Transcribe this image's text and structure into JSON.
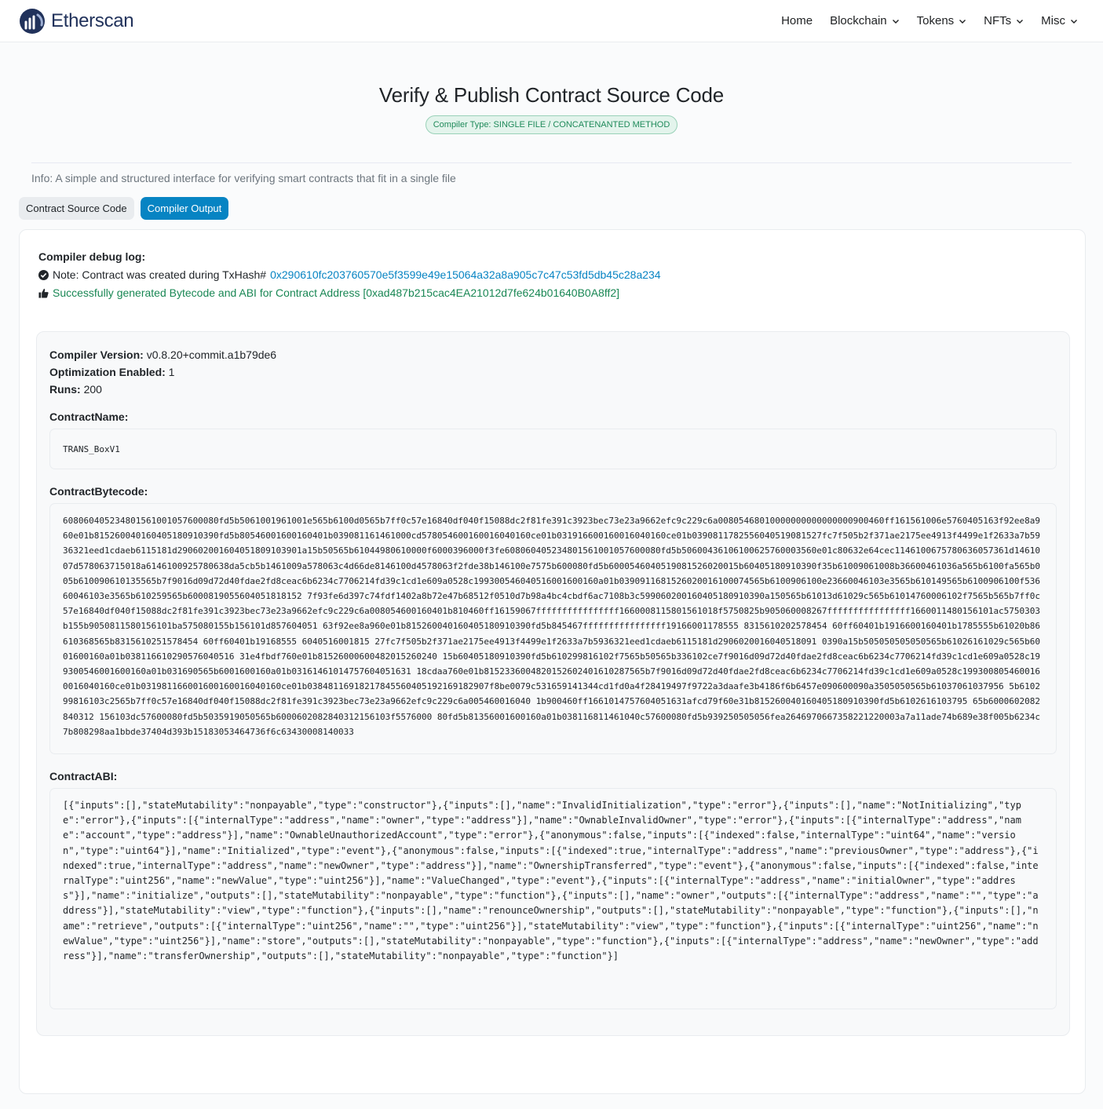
{
  "brand": {
    "name": "Etherscan"
  },
  "nav": {
    "items": [
      {
        "label": "Home",
        "dropdown": false
      },
      {
        "label": "Blockchain",
        "dropdown": true
      },
      {
        "label": "Tokens",
        "dropdown": true
      },
      {
        "label": "NFTs",
        "dropdown": true
      },
      {
        "label": "Misc",
        "dropdown": true
      }
    ]
  },
  "header": {
    "title": "Verify & Publish Contract Source Code",
    "badge": "Compiler Type: SINGLE FILE / CONCATENANTED METHOD",
    "info": "Info: A simple and structured interface for verifying smart contracts that fit in a single file"
  },
  "tabs": {
    "source": "Contract Source Code",
    "output": "Compiler Output"
  },
  "debug": {
    "title": "Compiler debug log:",
    "note_prefix": "Note: Contract was created during TxHash# ",
    "tx_hash": "0x290610fc203760570e5f3599e49e15064a32a8a905c7c47c53fd5db45c28a234",
    "success": "Successfully generated Bytecode and ABI for Contract Address [0xad487b215cac4EA21012d7fe624b01640B0A8ff2]"
  },
  "details": {
    "compiler_label": "Compiler Version:",
    "compiler_value": "v0.8.20+commit.a1b79de6",
    "optimization_label": "Optimization Enabled:",
    "optimization_value": "1",
    "runs_label": "Runs:",
    "runs_value": "200",
    "contract_name_label": "ContractName:",
    "contract_name": "TRANS_BoxV1",
    "bytecode_label": "ContractBytecode:",
    "bytecode": "608060405234801561001057600080fd5b5061001961001e565b6100d0565b7ff0c57e16840df040f15088dc2f81fe391c3923bec73e23a9662efc9c229c6a00805468010000000000000000900460ff161561006e5760405163f92ee8a960e01b815260040160405180910390fd5b80546001600160401b039081161461000cd578054600160016040160ce01b031916600160016040160ce01b0390811782556040519081527fc7f505b2f371ae2175ee4913f4499e1f2633a7b5936321eed1cdaeb6115181d290602001604051809103901a15b50565b61044980610000f6000396000f3fe608060405234801561001057600080fd5b50600436106100625760003560e01c80632e64cec1146100675780636057361d1461007d578063715018a6146100925780638da5cb5b1461009a578063c4d66de8146100d4578063f2fde38b146100e7575b600080fd5b6000546040519081526020015b60405180910390f35b61009061008b36600461036a565b6100fa565b005b610090610135565b7f9016d09d72d40fdae2fd8ceac6b6234c7706214fd39c1cd1e609a0528c199300546040516001600160a01b0390911681526020016100074565b6100906100e23660046103e3565b610149565b6100906100f53660046103e3565b610259565b6000819055604051818152 7f93fe6d397c74fdf1402a8b72e47b68512f0510d7b98a4bc4cbdf6ac7108b3c599060200160405180910390a150565b61013d61029c565b61014760006102f7565b565b7ff0c57e16840df040f15088dc2f81fe391c3923bec73e23a9662efc9c229c6a008054600160401b810460ff16159067ffffffffffffffff1660008115801561018f5750825b905060008267ffffffffffffffff1660011480156101ac5750303b155b9050811580156101ba575080155b156101d857604051 63f92ee8a960e01b815260040160405180910390fd5b845467ffffffffffffffff19166001178555 8315610202578454 60ff60401b1916600160401b1785555b61020b86610368565b8315610251578454 60ff60401b19168555 6040516001815 27fc7f505b2f371ae2175ee4913f4499e1f2633a7b5936321eed1cdaeb6115181d2906020016040518091 0390a15b505050505050565b61026161029c565b6001600160a01b038116610290576040516 31e4fbdf760e01b81526000600482015260240 15b60405180910390fd5b610299816102f7565b50565b336102ce7f9016d09d72d40fdae2fd8ceac6b6234c7706214fd39c1cd1e609a0528c199300546001600160a01b031690565b6001600160a01b03161461014757604051631 18cdaa760e01b8152336004820152602401610287565b7f9016d09d72d40fdae2fd8ceac6b6234c7706214fd39c1cd1e609a0528c1993008054600160016040160ce01b031981166001600160016040160ce01b03848116918217845560405192169182907f8be0079c531659141344cd1fd0a4f28419497f9722a3daafe3b4186f6b6457e090600090a3505050565b61037061037956 5b610299816103c2565b7ff0c57e16840df040f15088dc2f81fe391c3923bec73e23a9662efc9c229c6a005460016040 1b900460ff1661014757604051631afcd79f60e31b815260040160405180910390fd5b6102616103795 65b6000602082840312 156103dc57600080fd5b5035919050565b6000602082840312156103f5576000 80fd5b81356001600160a01b038116811461040c57600080fd5b939250505056fea2646970667358221220003a7a11ade74b689e38f005b6234c7b808298aa1bbde37404d393b15183053464736f6c63430008140033",
    "abi_label": "ContractABI:",
    "abi": "[{\"inputs\":[],\"stateMutability\":\"nonpayable\",\"type\":\"constructor\"},{\"inputs\":[],\"name\":\"InvalidInitialization\",\"type\":\"error\"},{\"inputs\":[],\"name\":\"NotInitializing\",\"type\":\"error\"},{\"inputs\":[{\"internalType\":\"address\",\"name\":\"owner\",\"type\":\"address\"}],\"name\":\"OwnableInvalidOwner\",\"type\":\"error\"},{\"inputs\":[{\"internalType\":\"address\",\"name\":\"account\",\"type\":\"address\"}],\"name\":\"OwnableUnauthorizedAccount\",\"type\":\"error\"},{\"anonymous\":false,\"inputs\":[{\"indexed\":false,\"internalType\":\"uint64\",\"name\":\"version\",\"type\":\"uint64\"}],\"name\":\"Initialized\",\"type\":\"event\"},{\"anonymous\":false,\"inputs\":[{\"indexed\":true,\"internalType\":\"address\",\"name\":\"previousOwner\",\"type\":\"address\"},{\"indexed\":true,\"internalType\":\"address\",\"name\":\"newOwner\",\"type\":\"address\"}],\"name\":\"OwnershipTransferred\",\"type\":\"event\"},{\"anonymous\":false,\"inputs\":[{\"indexed\":false,\"internalType\":\"uint256\",\"name\":\"newValue\",\"type\":\"uint256\"}],\"name\":\"ValueChanged\",\"type\":\"event\"},{\"inputs\":[{\"internalType\":\"address\",\"name\":\"initialOwner\",\"type\":\"address\"}],\"name\":\"initialize\",\"outputs\":[],\"stateMutability\":\"nonpayable\",\"type\":\"function\"},{\"inputs\":[],\"name\":\"owner\",\"outputs\":[{\"internalType\":\"address\",\"name\":\"\",\"type\":\"address\"}],\"stateMutability\":\"view\",\"type\":\"function\"},{\"inputs\":[],\"name\":\"renounceOwnership\",\"outputs\":[],\"stateMutability\":\"nonpayable\",\"type\":\"function\"},{\"inputs\":[],\"name\":\"retrieve\",\"outputs\":[{\"internalType\":\"uint256\",\"name\":\"\",\"type\":\"uint256\"}],\"stateMutability\":\"view\",\"type\":\"function\"},{\"inputs\":[{\"internalType\":\"uint256\",\"name\":\"newValue\",\"type\":\"uint256\"}],\"name\":\"store\",\"outputs\":[],\"stateMutability\":\"nonpayable\",\"type\":\"function\"},{\"inputs\":[{\"internalType\":\"address\",\"name\":\"newOwner\",\"type\":\"address\"}],\"name\":\"transferOwnership\",\"outputs\":[],\"stateMutability\":\"nonpayable\",\"type\":\"function\"}]"
  },
  "colors": {
    "accent": "#0784c3",
    "brand": "#21325b",
    "success": "#198754",
    "badge_bg": "#e3f4ec"
  },
  "icons": {
    "logo": "etherscan-logo-icon",
    "note": "check-circle-icon",
    "success": "thumbs-up-icon",
    "dropdown": "chevron-down-icon"
  }
}
